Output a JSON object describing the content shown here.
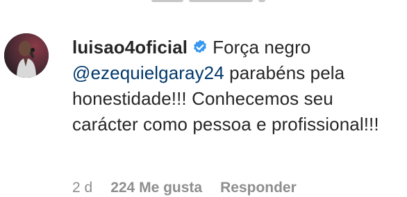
{
  "comment": {
    "username": "luisao4oficial",
    "verified_icon": "verified-badge-icon",
    "verified_color": "#3897f0",
    "text_before_mention": "Força negro",
    "mention": "@ezequielgaray24",
    "text_after_mention": "parabéns pela honestidade!!! Conhecemos seu carácter como pessoa e profissional!!!",
    "mention_color": "#00376b"
  },
  "footer": {
    "time": "2 d",
    "likes": "224 Me gusta",
    "reply": "Responder"
  }
}
